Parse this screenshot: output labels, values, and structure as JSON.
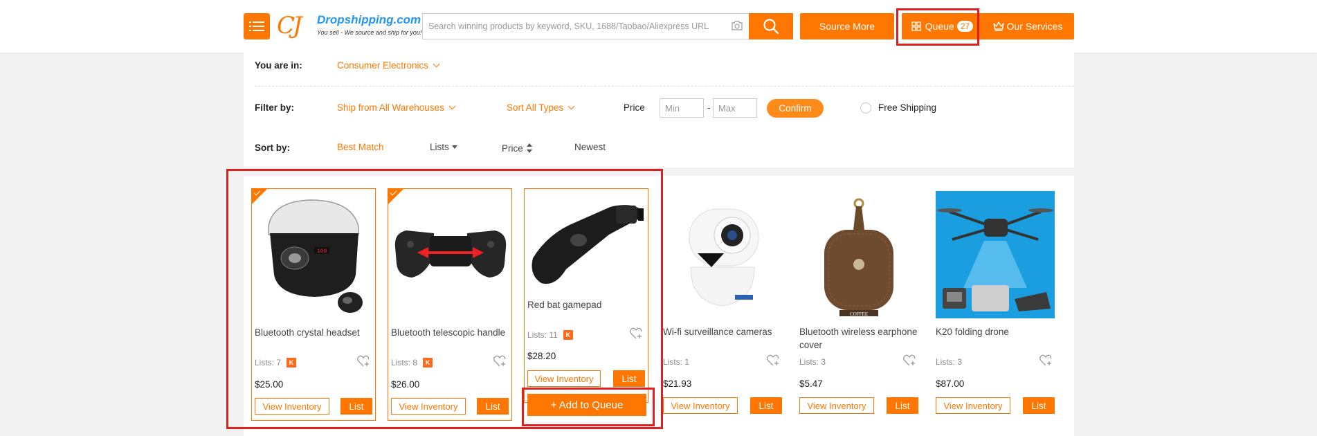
{
  "header": {
    "logo_mark": "CJ",
    "logo_brand": "Dropshipping.com",
    "logo_tagline": "You sell - We source and ship for you!",
    "search_placeholder": "Search winning products by keyword, SKU, 1688/Taobao/Aliexpress URL",
    "source_more": "Source More",
    "queue_label": "Queue",
    "queue_count": "27",
    "our_services": "Our Services",
    "accent_color": "#ff7700"
  },
  "filters": {
    "you_are_in_label": "You are in:",
    "category": "Consumer Electronics",
    "filter_by_label": "Filter by:",
    "warehouse": "Ship from All Warehouses",
    "sort_types": "Sort All Types",
    "price_label": "Price",
    "price_min_placeholder": "Min",
    "price_dash": "-",
    "price_max_placeholder": "Max",
    "confirm": "Confirm",
    "free_shipping": "Free Shipping",
    "sort_by_label": "Sort by:",
    "sort_best_match": "Best Match",
    "sort_lists": "Lists",
    "sort_price": "Price",
    "sort_newest": "Newest"
  },
  "products": [
    {
      "name": "Bluetooth crystal headset",
      "lists": "Lists: 7",
      "badge": "K",
      "price": "$25.00",
      "view_inventory": "View Inventory",
      "list": "List",
      "selected": true
    },
    {
      "name": "Bluetooth telescopic handle",
      "lists": "Lists: 8",
      "badge": "K",
      "price": "$26.00",
      "view_inventory": "View Inventory",
      "list": "List",
      "selected": true
    },
    {
      "name": "Red bat gamepad",
      "lists": "Lists: 11",
      "badge": "K",
      "price": "$28.20",
      "view_inventory": "View Inventory",
      "list": "List",
      "add_to_queue": "+ Add to Queue",
      "hovered": true
    },
    {
      "name": "Wi-fi surveillance cameras",
      "lists": "Lists: 1",
      "price": "$21.93",
      "view_inventory": "View Inventory",
      "list": "List"
    },
    {
      "name": "Bluetooth wireless earphone cover",
      "lists": "Lists: 3",
      "price": "$5.47",
      "view_inventory": "View Inventory",
      "list": "List",
      "image_text": "COFFEE"
    },
    {
      "name": "K20 folding drone",
      "lists": "Lists: 3",
      "price": "$87.00",
      "view_inventory": "View Inventory",
      "list": "List"
    }
  ]
}
